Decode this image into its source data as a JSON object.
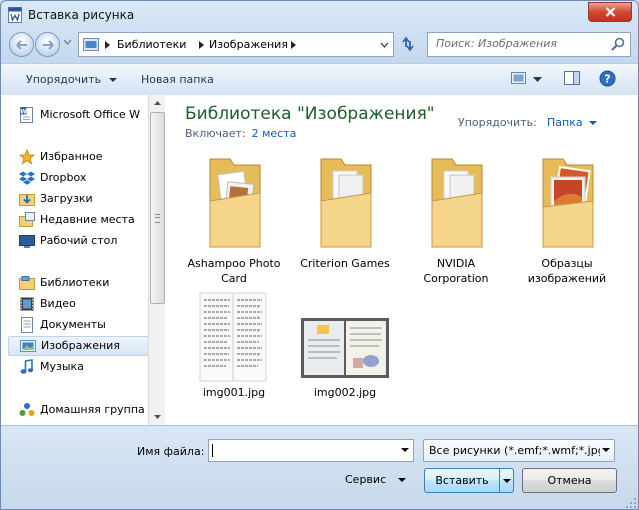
{
  "window": {
    "title": "Вставка рисунка"
  },
  "address": {
    "breadcrumbs": [
      "Библиотеки",
      "Изображения"
    ],
    "search_placeholder": "Поиск: Изображения"
  },
  "toolbar": {
    "organize_label": "Упорядочить",
    "new_folder_label": "Новая папка"
  },
  "navigation": {
    "items": [
      {
        "label": "Microsoft Office W",
        "icon": "word-document-icon"
      },
      {
        "label": "Избранное",
        "icon": "star-icon"
      },
      {
        "label": "Dropbox",
        "icon": "dropbox-icon"
      },
      {
        "label": "Загрузки",
        "icon": "downloads-folder-icon"
      },
      {
        "label": "Недавние места",
        "icon": "recent-places-icon"
      },
      {
        "label": "Рабочий стол",
        "icon": "desktop-icon"
      },
      {
        "label": "Библиотеки",
        "icon": "libraries-icon"
      },
      {
        "label": "Видео",
        "icon": "video-library-icon"
      },
      {
        "label": "Документы",
        "icon": "documents-library-icon"
      },
      {
        "label": "Изображения",
        "icon": "pictures-library-icon",
        "selected": true
      },
      {
        "label": "Музыка",
        "icon": "music-library-icon"
      },
      {
        "label": "Домашняя группа",
        "icon": "homegroup-icon"
      }
    ]
  },
  "library": {
    "title": "Библиотека \"Изображения\"",
    "includes_label": "Включает:",
    "includes_link": "2 места",
    "arrange_label": "Упорядочить:",
    "arrange_value": "Папка"
  },
  "items": [
    {
      "name": "Ashampoo Photo Card",
      "type": "folder"
    },
    {
      "name": "Criterion Games",
      "type": "folder"
    },
    {
      "name": "NVIDIA Corporation",
      "type": "folder"
    },
    {
      "name": "Образцы изображений",
      "type": "folder"
    },
    {
      "name": "img001.jpg",
      "type": "image"
    },
    {
      "name": "img002.jpg",
      "type": "image"
    }
  ],
  "footer": {
    "filename_label": "Имя файла:",
    "filename_value": "",
    "filter_value": "Все рисунки (*.emf;*.wmf;*.jpg",
    "tools_label": "Сервис",
    "insert_label": "Вставить",
    "cancel_label": "Отмена"
  }
}
